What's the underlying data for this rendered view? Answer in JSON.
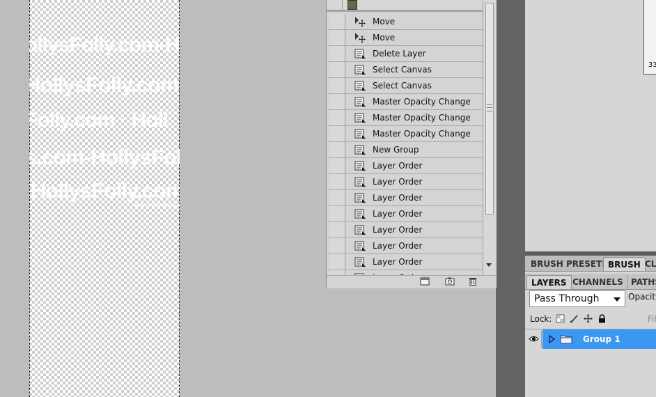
{
  "watermark": {
    "lines": [
      "ollysFolly.com-H",
      "HollysFolly.com",
      "Folly.com · Holl",
      "s.com-HollysFoll",
      "HollysFolly.com"
    ],
    "small": "www.hollysfolly.com"
  },
  "history": {
    "items": [
      {
        "label": "Move",
        "icon": "move-tool-icon"
      },
      {
        "label": "Move",
        "icon": "move-tool-icon"
      },
      {
        "label": "Delete Layer",
        "icon": "history-state-icon"
      },
      {
        "label": "Select Canvas",
        "icon": "history-state-icon"
      },
      {
        "label": "Select Canvas",
        "icon": "history-state-icon"
      },
      {
        "label": "Master Opacity Change",
        "icon": "history-state-icon"
      },
      {
        "label": "Master Opacity Change",
        "icon": "history-state-icon"
      },
      {
        "label": "Master Opacity Change",
        "icon": "history-state-icon"
      },
      {
        "label": "New Group",
        "icon": "history-state-icon"
      },
      {
        "label": "Layer Order",
        "icon": "history-state-icon"
      },
      {
        "label": "Layer Order",
        "icon": "history-state-icon"
      },
      {
        "label": "Layer Order",
        "icon": "history-state-icon"
      },
      {
        "label": "Layer Order",
        "icon": "history-state-icon"
      },
      {
        "label": "Layer Order",
        "icon": "history-state-icon"
      },
      {
        "label": "Layer Order",
        "icon": "history-state-icon"
      },
      {
        "label": "Layer Order",
        "icon": "history-state-icon"
      },
      {
        "label": "Layer Order",
        "icon": "history-state-icon"
      }
    ],
    "footer_icons": [
      "new-document-from-state-icon",
      "create-snapshot-icon",
      "delete-state-icon"
    ]
  },
  "navigator": {
    "zoom_fragment": "33"
  },
  "brush_tabs": [
    "BRUSH PRESETS",
    "BRUSH",
    "CL"
  ],
  "layer_tabs": [
    "LAYERS",
    "CHANNELS",
    "PATHS"
  ],
  "layers": {
    "blend_mode": "Pass Through",
    "opacity_label": "Opacity",
    "lock_label": "Lock:",
    "fill_label": "Fil",
    "group_name": "Group 1"
  },
  "colors": {
    "selection": "#3c97f0",
    "panel": "#d4d4d4"
  }
}
